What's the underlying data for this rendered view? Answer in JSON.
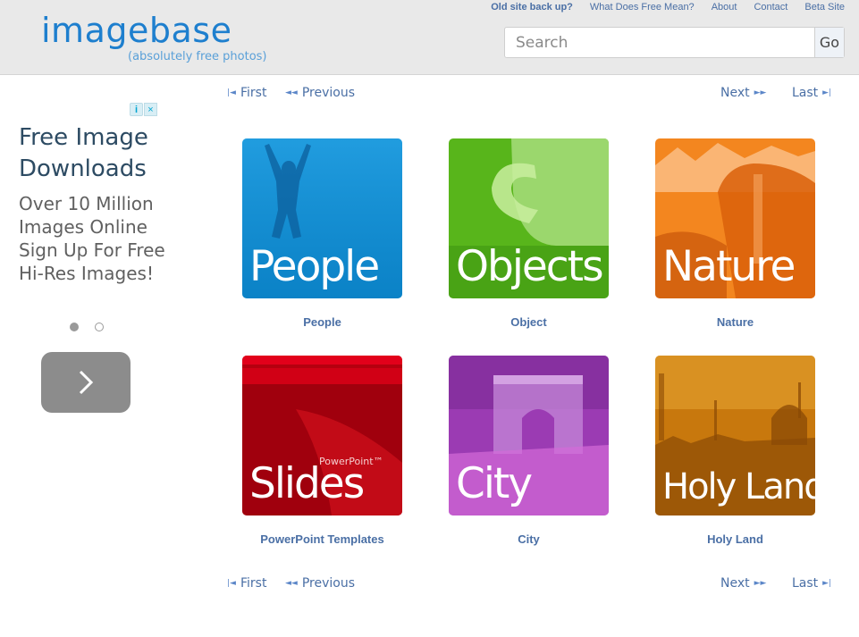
{
  "header": {
    "logo": "imagebase",
    "tagline": "(absolutely free photos)",
    "nav": [
      {
        "label": "Old site back up?",
        "bold": true
      },
      {
        "label": "What Does Free Mean?",
        "bold": false
      },
      {
        "label": "About",
        "bold": false
      },
      {
        "label": "Contact",
        "bold": false
      },
      {
        "label": "Beta Site",
        "bold": false
      }
    ],
    "search": {
      "placeholder": "Search",
      "value": "",
      "go_label": "Go"
    }
  },
  "ad": {
    "title": "Free Image Downloads",
    "body": "Over 10 Million Images Online Sign Up For Free Hi-Res Images!",
    "info_icon": "i",
    "close_icon": "×",
    "dots": [
      true,
      false
    ]
  },
  "pager": {
    "first": "First",
    "previous": "Previous",
    "next": "Next",
    "last": "Last"
  },
  "tiles": [
    {
      "word": "People",
      "caption": "People",
      "color": "#0b8fd6"
    },
    {
      "word": "Objects",
      "caption": "Object",
      "color": "#58b51b"
    },
    {
      "word": "Nature",
      "caption": "Nature",
      "color": "#f3861f"
    },
    {
      "word": "Slides",
      "caption": "PowerPoint Templates",
      "color": "#b5000f",
      "badge": "PowerPoint™"
    },
    {
      "word": "City",
      "caption": "City",
      "color": "#9b3bb3"
    },
    {
      "word": "Holy Land",
      "caption": "Holy Land",
      "color": "#c8780d"
    }
  ]
}
